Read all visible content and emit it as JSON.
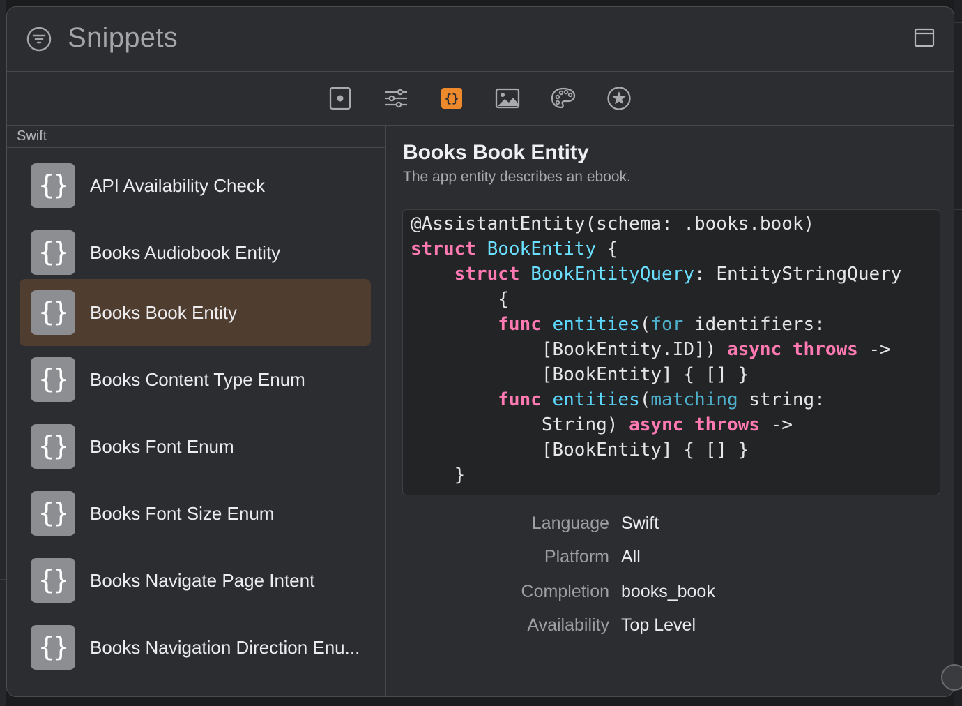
{
  "window": {
    "title": "Snippets"
  },
  "toolbar": {
    "icons": [
      "file-template-icon",
      "sliders-icon",
      "code-snippet-icon",
      "media-icon",
      "color-palette-icon",
      "star-icon"
    ],
    "active_index": 2,
    "accent_color": "#ef8a2c"
  },
  "sidebar": {
    "section_label": "Swift",
    "items": [
      {
        "label": "API Availability Check"
      },
      {
        "label": "Books Audiobook Entity"
      },
      {
        "label": "Books Book Entity",
        "selected": true
      },
      {
        "label": "Books Content Type Enum"
      },
      {
        "label": "Books Font Enum"
      },
      {
        "label": "Books Font Size Enum"
      },
      {
        "label": "Books Navigate Page Intent"
      },
      {
        "label": "Books Navigation Direction Enu..."
      }
    ],
    "icon_glyph": "{}",
    "selected_color": "#4f3d30"
  },
  "detail": {
    "title": "Books Book Entity",
    "subtitle": "The app entity describes an ebook.",
    "code": "@AssistantEntity(schema: .books.book)\nstruct BookEntity {\n    struct BookEntityQuery: EntityStringQuery\n        {\n        func entities(for identifiers:\n            [BookEntity.ID]) async throws ->\n            [BookEntity] { [] }\n        func entities(matching string:\n            String) async throws ->\n            [BookEntity] { [] }\n    }",
    "meta": [
      {
        "key": "Language",
        "value": "Swift"
      },
      {
        "key": "Platform",
        "value": "All"
      },
      {
        "key": "Completion",
        "value": "books_book"
      },
      {
        "key": "Availability",
        "value": "Top Level"
      }
    ]
  }
}
